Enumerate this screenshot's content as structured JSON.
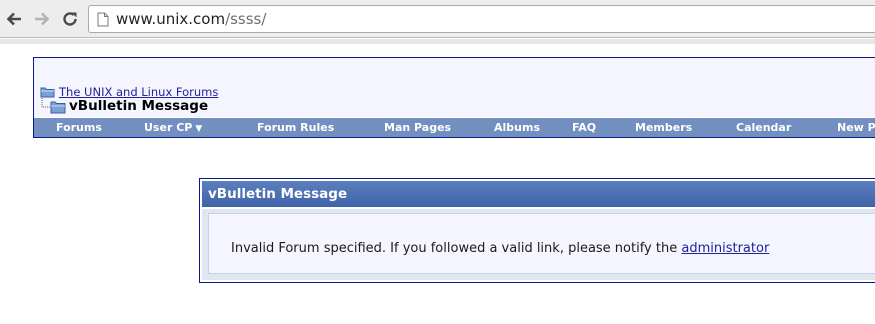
{
  "browser": {
    "url_host": "www.unix.com",
    "url_path": "/ssss/",
    "icons": {
      "back": "arrow-left-icon",
      "forward": "arrow-right-icon",
      "reload": "reload-icon",
      "page": "page-icon"
    }
  },
  "header": {
    "breadcrumb_parent": "The UNIX and Linux Forums",
    "breadcrumb_current": "vBulletin Message"
  },
  "navbar": {
    "items": [
      {
        "label": "Forums"
      },
      {
        "label": "User CP"
      },
      {
        "label": "Forum Rules"
      },
      {
        "label": "Man Pages"
      },
      {
        "label": "Albums"
      },
      {
        "label": "FAQ"
      },
      {
        "label": "Members"
      },
      {
        "label": "Calendar"
      },
      {
        "label": "New Po"
      }
    ]
  },
  "message": {
    "title": "vBulletin Message",
    "text": "Invalid Forum specified. If you followed a valid link, please notify the",
    "link_label": "administrator"
  },
  "colors": {
    "navbar_bg": "#738fbf",
    "header_border": "#0b198c",
    "link": "#22229c",
    "panel_head": "#4a6cb0"
  }
}
